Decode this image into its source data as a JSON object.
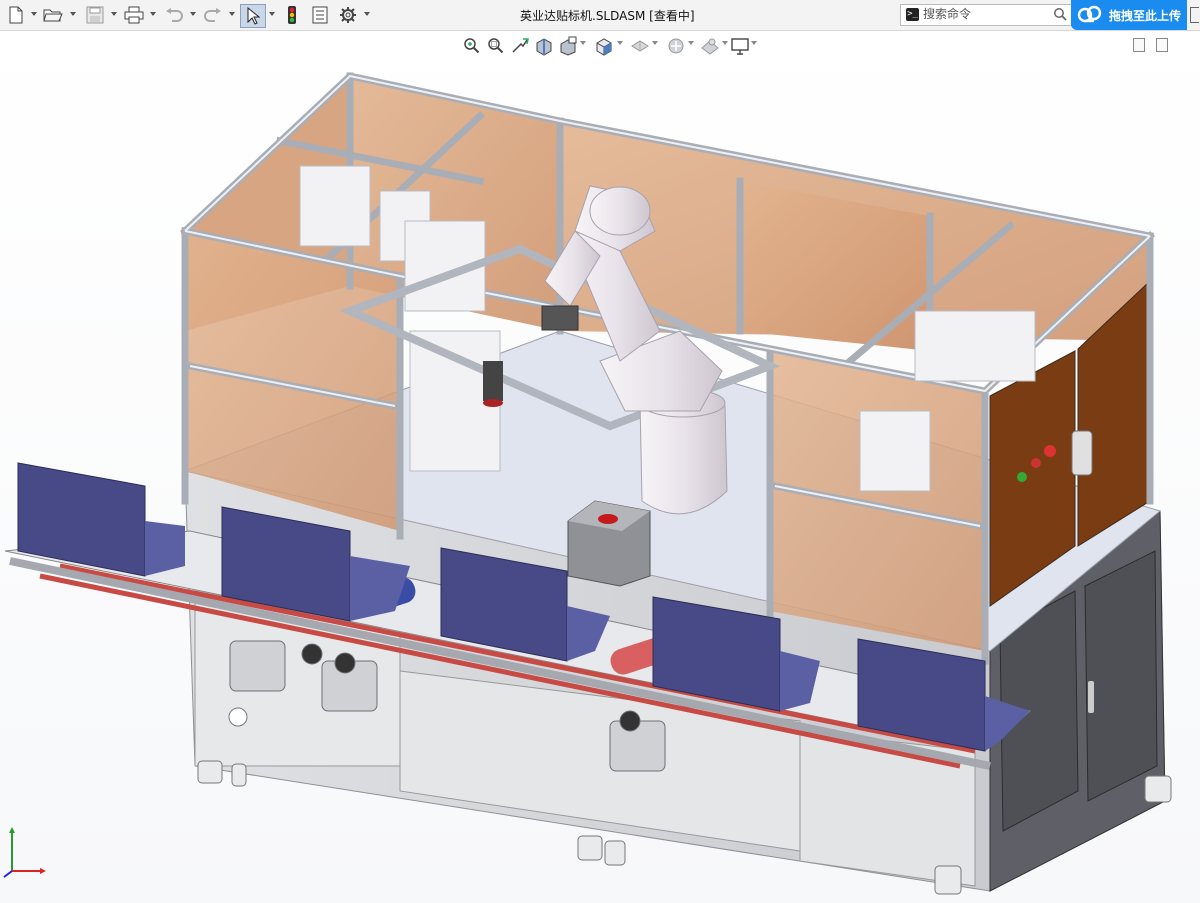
{
  "window": {
    "title": "英业达贴标机.SLDASM [查看中]"
  },
  "toolbar": {
    "icons": [
      "new-document-icon",
      "open-folder-icon",
      "save-icon",
      "print-icon",
      "undo-icon",
      "redo-icon",
      "select-pointer-icon",
      "traffic-light-icon",
      "file-properties-icon",
      "options-gear-icon"
    ]
  },
  "search": {
    "placeholder": "搜索命令"
  },
  "upload": {
    "label": "拖拽至此上传"
  },
  "colors": {
    "accent": "#1a8cf0",
    "frame": "#c9ccd2",
    "panel": "#d9a57f",
    "conveyor_pad": "#474a86",
    "belt": "#c84a44",
    "base": "#d6d7da"
  }
}
